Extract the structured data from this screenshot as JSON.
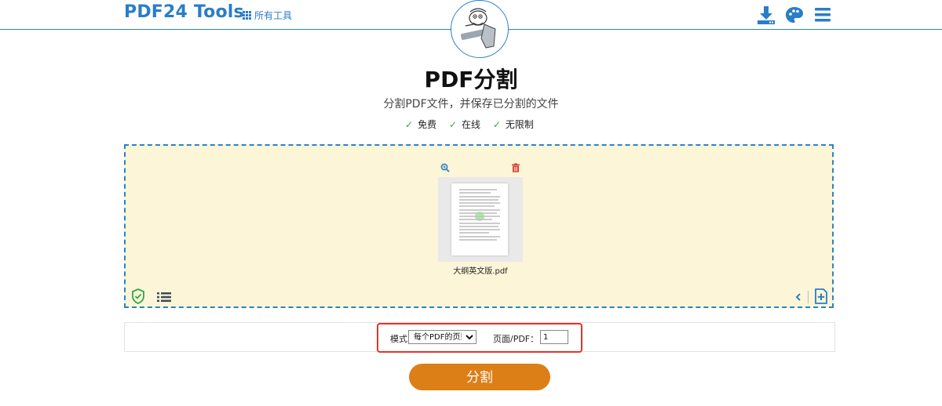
{
  "header": {
    "logo": "PDF24 Tools",
    "all_tools": "所有工具",
    "icons": [
      "download-icon",
      "palette-icon",
      "menu-icon"
    ]
  },
  "hero": {
    "title": "PDF分割",
    "subtitle": "分割PDF文件，并保存已分割的文件",
    "features": [
      "免费",
      "在线",
      "无限制"
    ],
    "check_glyph": "✓"
  },
  "dropzone": {
    "file_name": "大纲英文版.pdf",
    "icons": [
      "zoom-icon",
      "trash-icon",
      "shield-check-icon",
      "list-icon",
      "chevron-left-icon",
      "add-file-icon"
    ]
  },
  "options": {
    "mode_label": "模式",
    "mode_value": "每个PDF的页数",
    "pages_label": "页面/PDF：",
    "pages_value": "1"
  },
  "action": {
    "split_label": "分割"
  },
  "colors": {
    "brand_blue": "#2a7dc6",
    "dropzone_bg": "#fdf5d8",
    "button_orange": "#dc7f17",
    "highlight_red": "#e0352b",
    "check_green": "#2ea84a"
  }
}
